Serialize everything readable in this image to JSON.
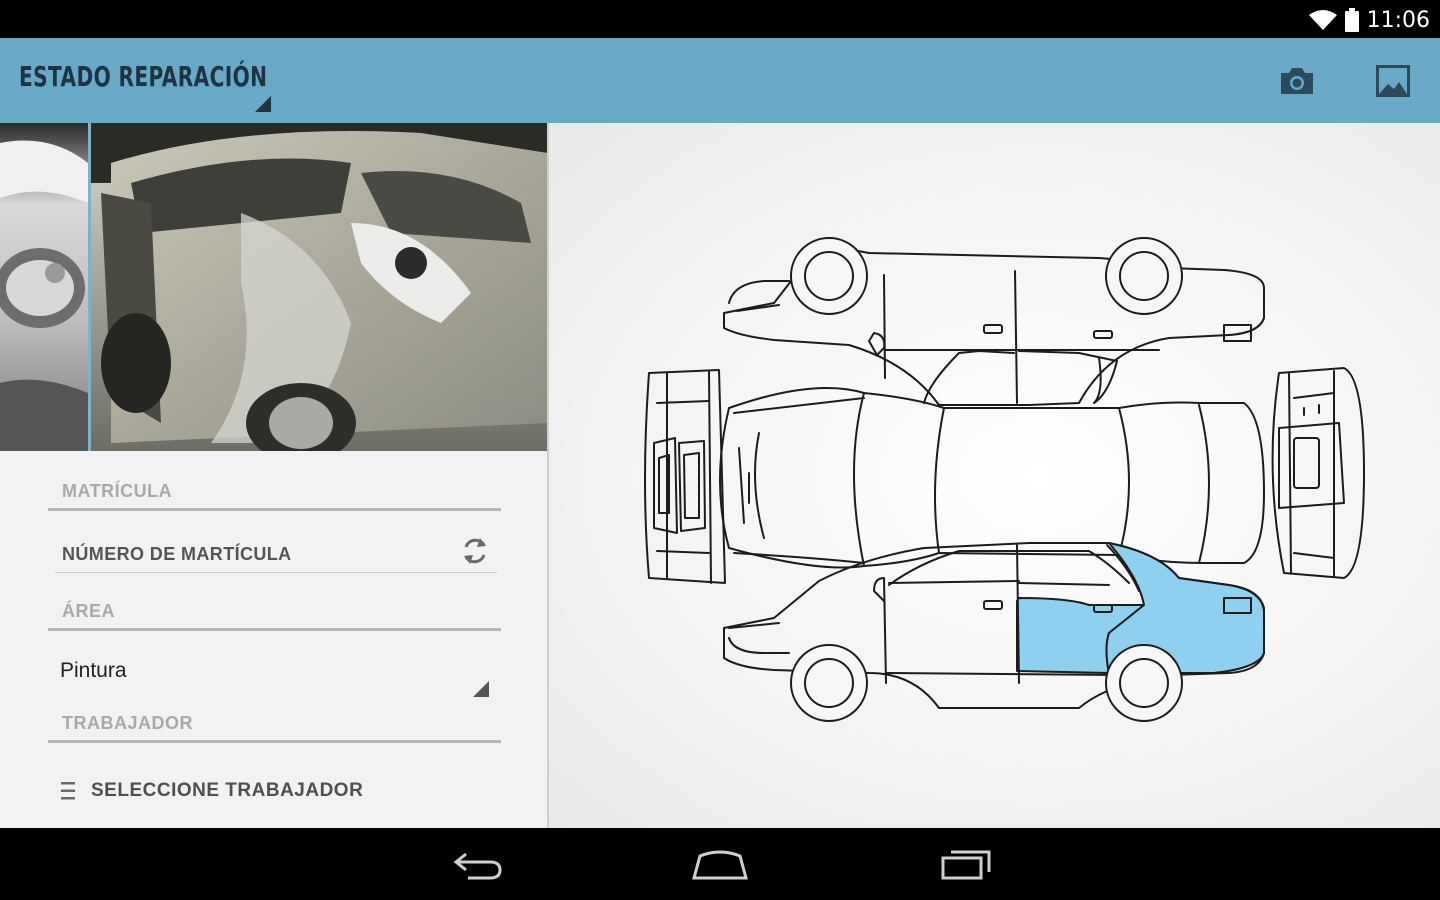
{
  "status_bar": {
    "time": "11:06",
    "wifi_icon": "wifi-icon",
    "battery_icon": "battery-icon"
  },
  "action_bar": {
    "title": "ESTADO REPARACIÓN",
    "background": "#69a9c6",
    "actions": [
      {
        "name": "camera-button",
        "icon": "camera-icon"
      },
      {
        "name": "gallery-button",
        "icon": "gallery-icon"
      }
    ]
  },
  "form": {
    "matricula_label": "MATRÍCULA",
    "matricula_value": "NÚMERO DE MARTÍCULA",
    "area_label": "ÁREA",
    "area_value": "Pintura",
    "worker_label": "TRABAJADOR",
    "worker_button": "SELECCIONE TRABAJADOR"
  },
  "car_diagram": {
    "selected_parts": [
      "right-rear-door",
      "right-rear-quarter"
    ],
    "highlight_color": "#8fd0ee",
    "outline_color": "#1c1c1c"
  },
  "navigation": {
    "buttons": [
      "back-icon",
      "home-icon",
      "recents-icon"
    ]
  }
}
